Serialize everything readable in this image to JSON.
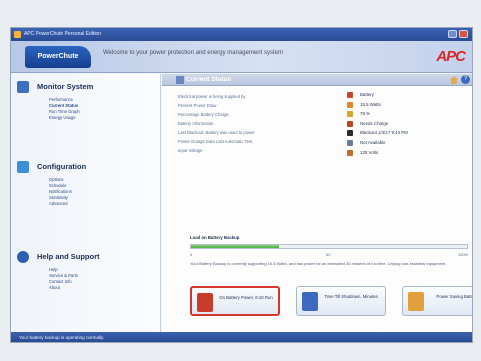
{
  "window": {
    "title": "APC PowerChute Personal Edition"
  },
  "banner": {
    "logo_text": "PowerChute",
    "welcome": "Welcome to your power protection and energy management system",
    "brand": "APC"
  },
  "sidebar": {
    "sections": [
      {
        "title": "Monitor System",
        "icon": "monitor-icon",
        "color": "#3c6fc0",
        "items": [
          "Performance",
          "Current Status",
          "Run Time Graph",
          "Energy Usage"
        ],
        "active_index": 1
      },
      {
        "title": "Configuration",
        "icon": "configuration-icon",
        "color": "#3c8fd6",
        "items": [
          "Options",
          "Schedule",
          "Notifications",
          "Sensitivity",
          "Advanced"
        ],
        "active_index": -1
      },
      {
        "title": "Help and Support",
        "icon": "help-support-icon",
        "color": "#2d5fb3",
        "items": [
          "Help",
          "Service & Parts",
          "Contact Info",
          "About"
        ],
        "active_index": -1
      }
    ]
  },
  "main": {
    "title": "Current Status",
    "status_labels": [
      "Electrical power is being supplied by",
      "Present Power Draw",
      "Percentage Battery Charge",
      "Battery Information",
      "Last Blackout: Battery was used to power",
      "Power Outage Data Last Automatic Test",
      "Input Voltage"
    ],
    "status_values": [
      {
        "text": "Battery",
        "icon": "battery-icon",
        "color": "#c8462a"
      },
      {
        "text": "15.5 Watts",
        "icon": "power-icon",
        "color": "#d8892c"
      },
      {
        "text": "78 %",
        "icon": "charge-icon",
        "color": "#d8a82c"
      },
      {
        "text": "Needs Charge",
        "icon": "plug-icon",
        "color": "#b9481f"
      },
      {
        "text": "Blackout 1/4/17 9:43 PM",
        "icon": "blackout-icon",
        "color": "#2a2a2a"
      },
      {
        "text": "Not Available",
        "icon": "test-icon",
        "color": "#6b7a95"
      },
      {
        "text": "125 Volts",
        "icon": "voltage-icon",
        "color": "#c26e2a"
      }
    ],
    "load": {
      "label": "Load on Battery Backup",
      "percent": 32,
      "scale": [
        "0",
        "50",
        "100%"
      ],
      "note": "Your Battery Backup is currently supporting 15.5 Watts, and has power for an estimated 30 minutes of run time. Unplug non-essential equipment."
    },
    "buttons": [
      {
        "label": "On Battery Power, 8:10 Run",
        "icon": "battery-button-icon",
        "color": "#c73c2a"
      },
      {
        "label": "Time Till Shutdown, Minutes",
        "icon": "shutdown-timer-icon",
        "color": "#3d6ac0"
      },
      {
        "label": "Power Saving Battery",
        "icon": "power-saving-icon",
        "color": "#e0a03b"
      }
    ],
    "highlight_index": 0
  },
  "statusbar": {
    "text": "Your battery backup is operating normally."
  }
}
